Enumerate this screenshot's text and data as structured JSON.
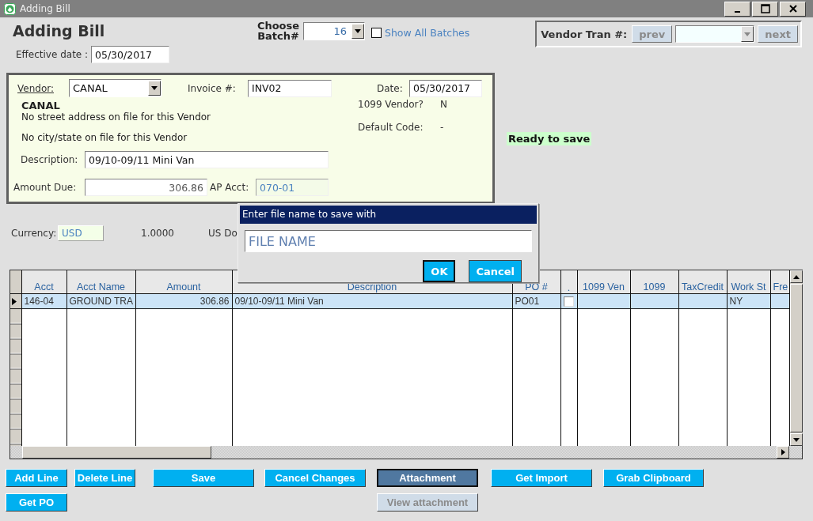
{
  "window": {
    "title": "Adding Bill"
  },
  "header": {
    "title": "Adding Bill",
    "effective_date": {
      "label": "Effective date :",
      "value": "05/30/2017"
    }
  },
  "batch": {
    "label": "Choose Batch#",
    "value": "16",
    "show_all": {
      "label": "Show All Batches",
      "checked": false
    }
  },
  "vendor_tran": {
    "label": "Vendor Tran #:",
    "prev": {
      "label": "prev",
      "disabled": true
    },
    "next": {
      "label": "next",
      "disabled": true
    }
  },
  "vendor": {
    "label": "Vendor:",
    "value": "CANAL",
    "invoice": {
      "label": "Invoice #:",
      "value": "INV02"
    },
    "date": {
      "label": "Date:",
      "value": "05/30/2017"
    },
    "name": "CANAL",
    "street": "No street address on file for this Vendor",
    "city_state": "No city/state on file for this Vendor",
    "info": [
      {
        "label": "1099 Vendor?",
        "value": "N"
      },
      {
        "label": "Default Code:",
        "value": "-"
      }
    ],
    "description": {
      "label": "Description:",
      "value": "09/10-09/11 Mini Van"
    },
    "amount_due": {
      "label": "Amount Due:",
      "value": "306.86"
    },
    "ap_acct": {
      "label": "AP Acct:",
      "value": "070-01",
      "disabled": true
    }
  },
  "status": "Ready to save",
  "currency": {
    "label": "Currency:",
    "value": "USD",
    "rate": "1.0000",
    "name": "US Do"
  },
  "grid": {
    "columns": [
      {
        "label": "Acct",
        "kind": "text"
      },
      {
        "label": "Acct Name",
        "kind": "text"
      },
      {
        "label": "Amount",
        "kind": "number"
      },
      {
        "label": "Description",
        "kind": "text"
      },
      {
        "label": "PO #",
        "kind": "text"
      },
      {
        "label": ".",
        "kind": "check"
      },
      {
        "label": "1099 Ven",
        "kind": "text"
      },
      {
        "label": "1099",
        "kind": "text"
      },
      {
        "label": "TaxCredit",
        "kind": "text"
      },
      {
        "label": "Work St",
        "kind": "text"
      },
      {
        "label": "Fre",
        "kind": "text"
      }
    ],
    "rows": [
      {
        "selected": true,
        "checked": false,
        "cells": [
          "146-04",
          "GROUND TRA",
          "306.86",
          "09/10-09/11 Mini Van",
          "PO01",
          "",
          "",
          "",
          "",
          "NY",
          ""
        ]
      }
    ]
  },
  "button_columns": [
    [
      {
        "label": "Add Line",
        "focused": false,
        "disabled": false
      },
      {
        "label": "Get PO",
        "focused": false,
        "disabled": false
      }
    ],
    [
      {
        "label": "Delete Line",
        "focused": false,
        "disabled": false
      }
    ],
    [
      {
        "label": "Save",
        "focused": false,
        "disabled": false
      }
    ],
    [
      {
        "label": "Cancel Changes",
        "focused": false,
        "disabled": false
      }
    ],
    [
      {
        "label": "Attachment",
        "focused": true,
        "disabled": false
      },
      {
        "label": "View attachment",
        "focused": false,
        "disabled": true
      }
    ],
    [
      {
        "label": "Get Import",
        "focused": false,
        "disabled": false
      }
    ],
    [
      {
        "label": "Grab Clipboard",
        "focused": false,
        "disabled": false
      }
    ]
  ],
  "dialog": {
    "title": "Enter file name to save with",
    "value": "FILE NAME",
    "buttons": [
      {
        "label": "OK",
        "default": true
      },
      {
        "label": "Cancel",
        "default": false
      }
    ]
  }
}
